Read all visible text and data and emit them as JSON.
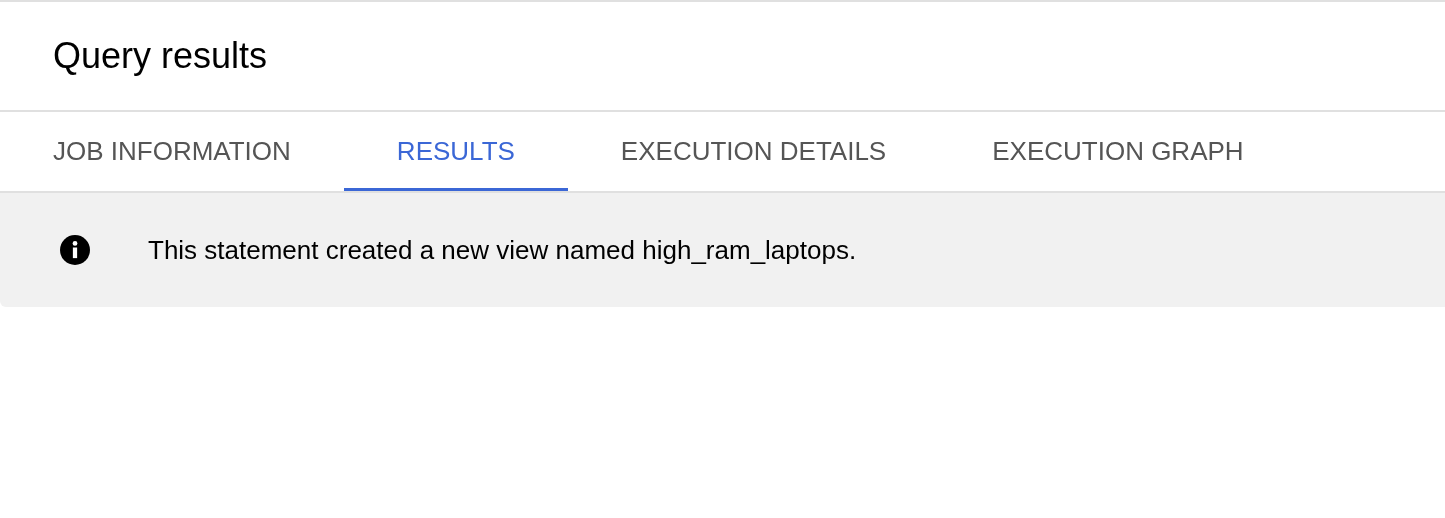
{
  "header": {
    "title": "Query results"
  },
  "tabs": [
    {
      "label": "JOB INFORMATION",
      "selected": false
    },
    {
      "label": "RESULTS",
      "selected": true
    },
    {
      "label": "EXECUTION DETAILS",
      "selected": false
    },
    {
      "label": "EXECUTION GRAPH",
      "selected": false
    }
  ],
  "info_banner": {
    "message": "This statement created a new view named high_ram_laptops."
  }
}
